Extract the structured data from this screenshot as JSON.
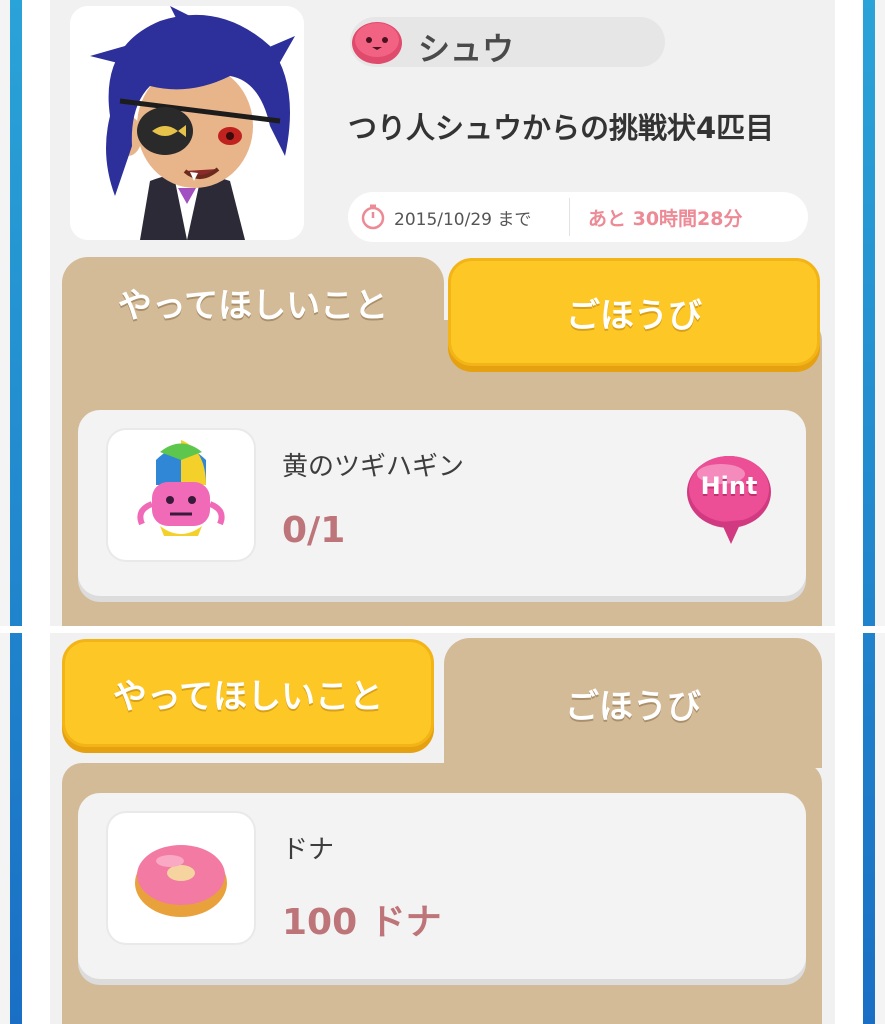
{
  "header": {
    "character_name": "シュウ",
    "quest_title": "つり人シュウからの挑戦状4匹目",
    "deadline_date": "2015/10/29 まで",
    "remaining": "あと 30時間28分"
  },
  "top_view": {
    "tabs": [
      {
        "label": "やってほしいこと",
        "state": "selected"
      },
      {
        "label": "ごほうび",
        "state": "unselected"
      }
    ],
    "task": {
      "name": "黄のツギハギン",
      "progress": "0/1",
      "hint_label": "Hint"
    }
  },
  "bottom_view": {
    "tabs": [
      {
        "label": "やってほしいこと",
        "state": "unselected"
      },
      {
        "label": "ごほうび",
        "state": "selected"
      }
    ],
    "reward": {
      "name": "ドナ",
      "amount": "100 ドナ"
    }
  },
  "icons": {
    "character": "pink-slime-icon",
    "timer": "clock-icon",
    "task": "patchwork-monster-icon",
    "reward": "donut-icon",
    "hint": "hint-speech-bubble-icon"
  },
  "colors": {
    "tab_yellow": "#fdc826",
    "tab_brown": "#d4bb98",
    "value_text": "#bd7579",
    "remaining_text": "#ec8a95",
    "hint_pink": "#ec4f95",
    "edge_blue": "#1a6fc4"
  }
}
